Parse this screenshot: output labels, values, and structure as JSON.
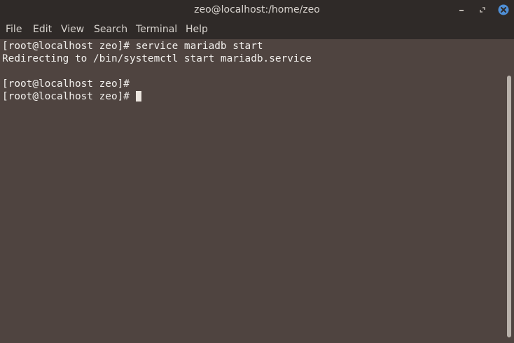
{
  "window": {
    "title": "zeo@localhost:/home/zeo"
  },
  "menu": {
    "items": [
      "File",
      "Edit",
      "View",
      "Search",
      "Terminal",
      "Help"
    ]
  },
  "terminal": {
    "lines": [
      "[root@localhost zeo]# service mariadb start",
      "Redirecting to /bin/systemctl start mariadb.service",
      "",
      "[root@localhost zeo]#",
      "[root@localhost zeo]# "
    ]
  },
  "icons": {
    "minimize": "minimize-icon",
    "maximize": "maximize-icon",
    "close": "close-icon"
  },
  "colors": {
    "background": "#4f4440",
    "titlebar": "#2f2a28",
    "close_button": "#4f8fd6",
    "text": "#f2f0ed"
  }
}
